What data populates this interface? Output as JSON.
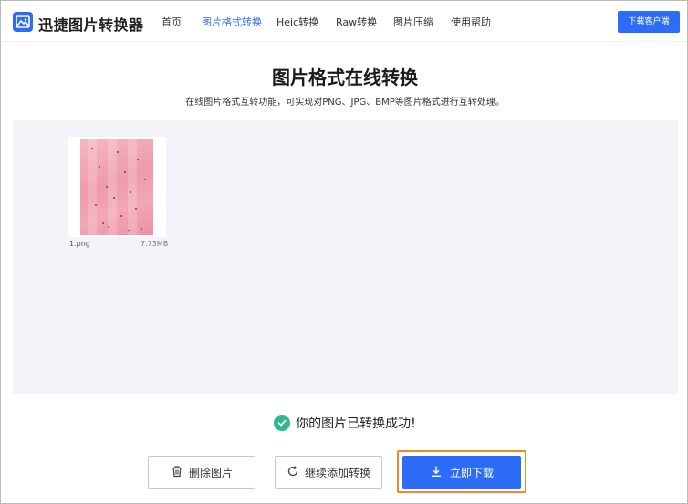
{
  "header": {
    "brand": "迅捷图片转换器",
    "nav": [
      {
        "label": "首页"
      },
      {
        "label": "图片格式转换",
        "active": true
      },
      {
        "label": "Heic转换"
      },
      {
        "label": "Raw转换"
      },
      {
        "label": "图片压缩"
      },
      {
        "label": "使用帮助"
      }
    ],
    "download_client": "下载客户端"
  },
  "main": {
    "title": "图片格式在线转换",
    "subtitle": "在线图片格式互转功能，可实现对PNG、JPG、BMP等图片格式进行互转处理。"
  },
  "file": {
    "name": "1.png",
    "size": "7.73MB"
  },
  "status": {
    "message": "你的图片已转换成功!"
  },
  "actions": {
    "delete_label": "删除图片",
    "add_label": "继续添加转换",
    "download_label": "立即下载"
  },
  "colors": {
    "accent": "#2c6cf6",
    "success": "#2dbb8b",
    "highlight": "#f08a24",
    "work_area_bg": "#f3f4f7"
  },
  "icons": {
    "logo": "image-logo-icon",
    "success": "check-circle-icon",
    "delete": "trash-icon",
    "add": "refresh-icon",
    "download": "download-icon"
  }
}
